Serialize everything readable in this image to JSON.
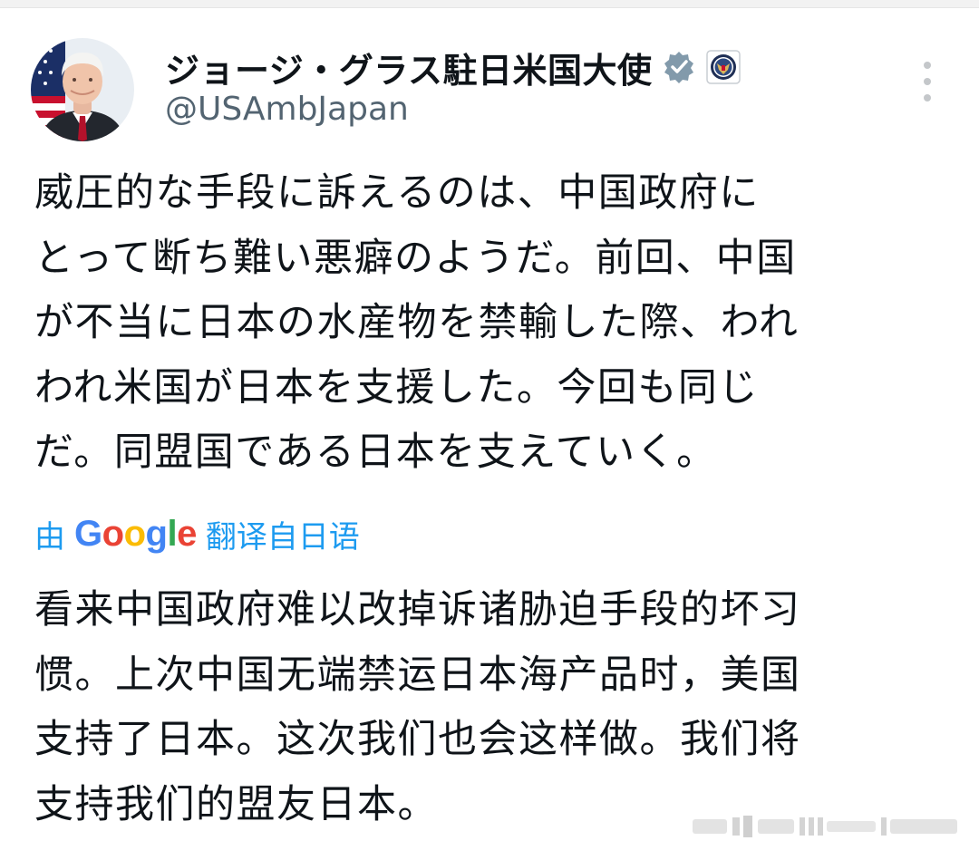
{
  "author": {
    "display_name": "ジョージ・グラス駐日米国大使",
    "handle": "@USAmbJapan",
    "verified_badge_icon": "verified-badge-icon",
    "affiliation_icon": "state-department-seal-icon",
    "avatar_icon": "profile-photo-avatar"
  },
  "tweet": {
    "text": "威圧的な手段に訴えるのは、中国政府に\nとって断ち難い悪癖のようだ。前回、中国\nが不当に日本の水産物を禁輸した際、われ\nわれ米国が日本を支援した。今回も同じ\nだ。同盟国である日本を支えていく。"
  },
  "translation": {
    "prefix": "由",
    "google": [
      "G",
      "o",
      "o",
      "g",
      "l",
      "e"
    ],
    "suffix": "翻译自日语",
    "text": "看来中国政府难以改掉诉诸胁迫手段的坏习\n惯。上次中国无端禁运日本海产品时，美国\n支持了日本。这次我们也会这样做。我们将\n支持我们的盟友日本。"
  },
  "icons": {
    "more": "more-options-icon"
  },
  "colors": {
    "text": "#0f1419",
    "secondary": "#536471",
    "link": "#1d9bf0",
    "verified_badge": "#829aab",
    "google_blue": "#4285f4",
    "google_red": "#ea4335",
    "google_yellow": "#fbbc05",
    "google_green": "#34a853"
  }
}
